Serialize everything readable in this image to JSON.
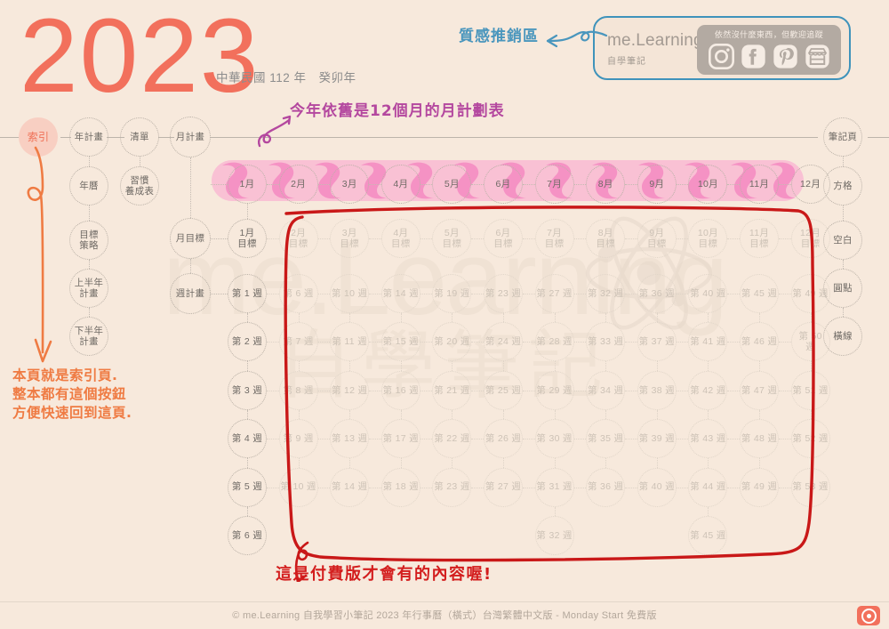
{
  "header": {
    "year": "2023",
    "subtitle": "中華民國 112 年　癸卯年"
  },
  "watermark": {
    "line1": "me.Learning",
    "line2": "自學筆記"
  },
  "logo_card": {
    "title": "me.Learning",
    "subtitle": "自學筆記",
    "social_caption": "依然沒什麼東西，但歡迎追蹤",
    "icons": [
      "instagram-icon",
      "facebook-icon",
      "pinterest-icon",
      "shop-icon"
    ],
    "border_color": "#3f93bb"
  },
  "index_button": {
    "label": "索引"
  },
  "left_nav": {
    "columns": [
      {
        "items": [
          {
            "label": "年計畫"
          },
          {
            "label": "年曆"
          },
          {
            "label": "目標\n策略"
          },
          {
            "label": "上半年\n計畫"
          },
          {
            "label": "下半年\n計畫"
          }
        ]
      },
      {
        "items": [
          {
            "label": "清單"
          },
          {
            "label": "習慣\n養成表"
          }
        ]
      }
    ]
  },
  "row_labels": {
    "month_plan": "月計畫",
    "month_goal": "月目標",
    "week_plan": "週計畫",
    "weeks": [
      "第 1 週",
      "第 2 週",
      "第 3 週",
      "第 4 週",
      "第 5 週",
      "第 6 週"
    ]
  },
  "months": [
    "1月",
    "2月",
    "3月",
    "4月",
    "5月",
    "6月",
    "7月",
    "8月",
    "9月",
    "10月",
    "11月",
    "12月"
  ],
  "month_goals": [
    "1月\n目標",
    "2月\n目標",
    "3月\n目標",
    "4月\n目標",
    "5月\n目標",
    "6月\n目標",
    "7月\n目標",
    "8月\n目標",
    "9月\n目標",
    "10月\n目標",
    "11月\n目標",
    "12月\n目標"
  ],
  "week_grid": {
    "rows": [
      [
        "第 1 週",
        "第 6 週",
        "第 10 週",
        "第 14 週",
        "第 19 週",
        "第 23 週",
        "第 27 週",
        "第 32 週",
        "第 36 週",
        "第 40 週",
        "第 45 週",
        "第 49 週"
      ],
      [
        "第 2 週",
        "第 7 週",
        "第 11 週",
        "第 15 週",
        "第 20 週",
        "第 24 週",
        "第 28 週",
        "第 33 週",
        "第 37 週",
        "第 41 週",
        "第 46 週",
        "第 50\n週"
      ],
      [
        "第 3 週",
        "第 8 週",
        "第 12 週",
        "第 16 週",
        "第 21 週",
        "第 25 週",
        "第 29 週",
        "第 34 週",
        "第 38 週",
        "第 42 週",
        "第 47 週",
        "第 51 週"
      ],
      [
        "第 4 週",
        "第 9 週",
        "第 13 週",
        "第 17 週",
        "第 22 週",
        "第 26 週",
        "第 30 週",
        "第 35 週",
        "第 39 週",
        "第 43 週",
        "第 48 週",
        "第 52 週"
      ],
      [
        "第 5 週",
        "第 10 週",
        "第 14 週",
        "第 18 週",
        "第 23 週",
        "第 27 週",
        "第 31 週",
        "第 36 週",
        "第 40 週",
        "第 44 週",
        "第 49 週",
        "第 53 週"
      ],
      [
        "第 6 週",
        "",
        "",
        "",
        "",
        "",
        "第 32 週",
        "",
        "",
        "第 45 週",
        "",
        ""
      ]
    ]
  },
  "right_nav": {
    "items": [
      {
        "label": "筆記頁"
      },
      {
        "label": "方格"
      },
      {
        "label": "空白"
      },
      {
        "label": "圓點"
      },
      {
        "label": "橫線"
      }
    ]
  },
  "annotations": {
    "purple_months": "今年依舊是12個月的月計劃表",
    "blue_promo": "質感推銷區",
    "orange_index": "本頁就是索引頁.\n整本都有這個按鈕\n方便快速回到這頁.",
    "red_paid": "這是付費版才會有的內容喔!"
  },
  "footer": {
    "text": "© me.Learning 自我學習小筆記 2023 年行事曆（橫式）台灣繁體中文版 - Monday Start 免費版",
    "badge_color": "#f2705c"
  },
  "colors": {
    "background": "#f7e9dc",
    "accent_red": "#f2705c",
    "highlighter_pink": "#f79ec6",
    "annotation_red": "#d31d1d",
    "annotation_orange": "#ef7b43",
    "annotation_purple": "#b4489f",
    "annotation_blue": "#4a96bd"
  }
}
